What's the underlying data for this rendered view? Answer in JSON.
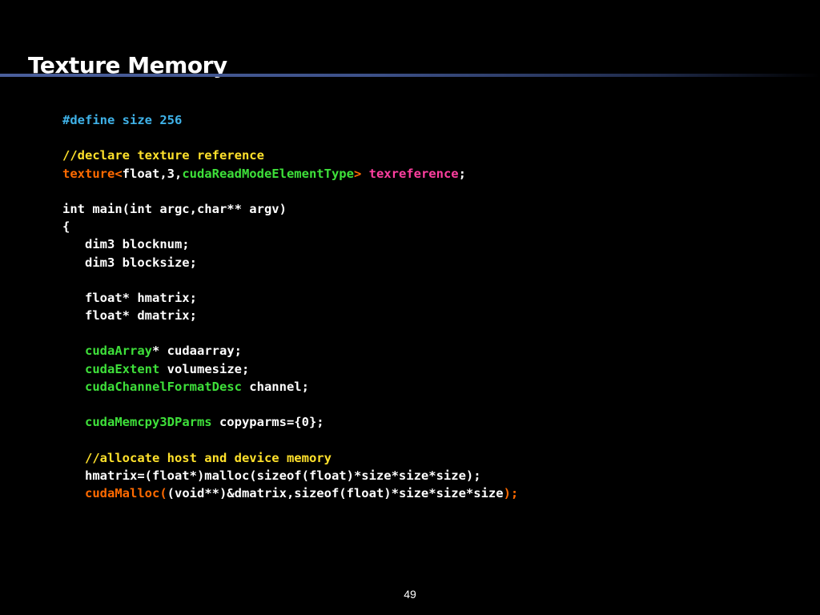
{
  "slide": {
    "title": "Texture Memory",
    "page_number": "49"
  },
  "colors": {
    "background": "#000000",
    "preprocessor": "#3fb2e8",
    "comment": "#ffe12b",
    "keyword": "#ff6a00",
    "cuda_type": "#3ee03a",
    "identifier": "#ff3fa0",
    "text": "#ffffff"
  },
  "code": {
    "define": "#define size 256",
    "comment_declare": "//declare texture reference",
    "tex_kw": "texture<",
    "tex_float": "float,3,",
    "tex_mode": "cudaReadModeElementType",
    "tex_close": ">",
    "tex_space": " ",
    "tex_name": "texreference",
    "tex_semi": ";",
    "main_sig": "int main(int argc,char** argv)",
    "open_brace": "{",
    "dim3_blocknum": "   dim3 blocknum;",
    "dim3_blocksize": "   dim3 blocksize;",
    "float_hmatrix": "   float* hmatrix;",
    "float_dmatrix": "   float* dmatrix;",
    "indent": "   ",
    "cudaarray_type": "cudaArray",
    "cudaarray_rest": "* cudaarray;",
    "extent_type": "cudaExtent",
    "extent_rest": " volumesize;",
    "channel_type": "cudaChannelFormatDesc",
    "channel_rest": " channel;",
    "memcpy_type": "cudaMemcpy3DParms",
    "memcpy_rest": " copyparms={0};",
    "comment_alloc": "   //allocate host and device memory",
    "hmatrix_alloc": "   hmatrix=(float*)malloc(sizeof(float)*size*size*size);",
    "malloc_fn": "cudaMalloc(",
    "malloc_args": "(void**)&dmatrix,sizeof(float)*size*size*size",
    "malloc_close": ");"
  }
}
